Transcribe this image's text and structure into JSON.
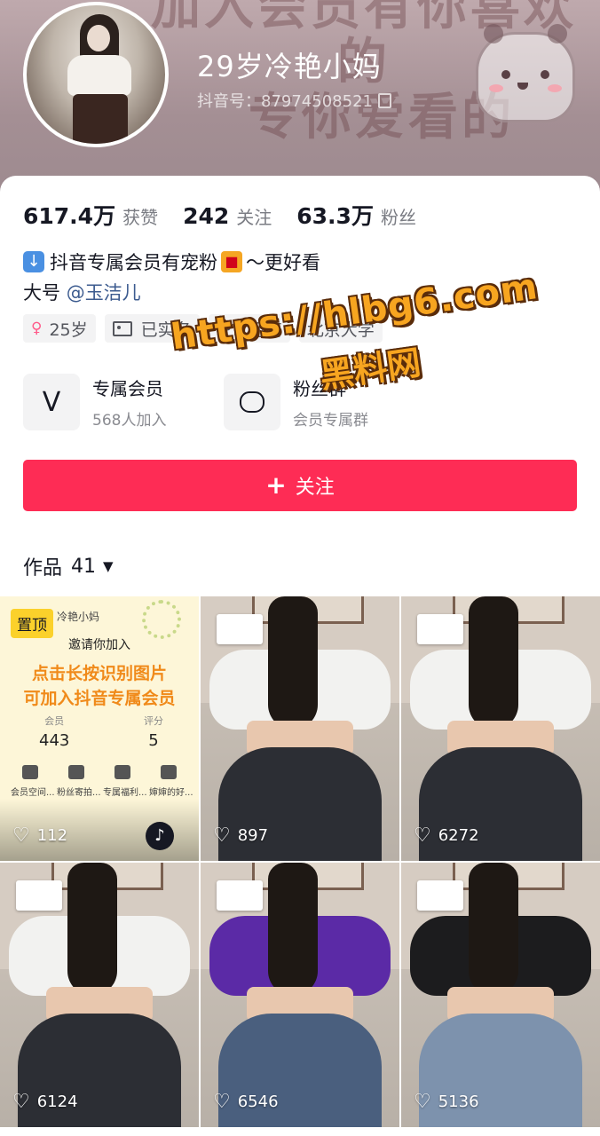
{
  "header": {
    "banner_line1": "加入会员有你喜欢的",
    "banner_line2": "专你爱看的",
    "nickname": "29岁冷艳小妈",
    "douyin_id": "抖音号：87974508521"
  },
  "stats": [
    {
      "value": "617.4万",
      "label": "获赞"
    },
    {
      "value": "242",
      "label": "关注"
    },
    {
      "value": "63.3万",
      "label": "粉丝"
    }
  ],
  "bio": {
    "line1": "抖音专属会员有宠粉",
    "line1_tail": "～更好看",
    "line2_prefix": "大号",
    "mention": "@玉洁儿"
  },
  "tags": [
    {
      "icon": "venus-icon",
      "glyph": "♀",
      "label": "25岁"
    },
    {
      "icon": "id-card-icon",
      "glyph": "",
      "label": "已实名"
    },
    {
      "icon": "",
      "glyph": "",
      "label": "IP：河南"
    },
    {
      "icon": "",
      "glyph": "",
      "label": "北京大学"
    }
  ],
  "entries": [
    {
      "title": "专属会员",
      "sub": "568人加入"
    },
    {
      "title": "粉丝群",
      "sub": "会员专属群"
    }
  ],
  "follow_button": {
    "label": "关注"
  },
  "works": {
    "label": "作品",
    "count": "41"
  },
  "grid": {
    "pinned_badge": "置顶",
    "promo": {
      "title": "冷艳小妈",
      "invite": "邀请你加入",
      "line1": "点击长按识别图片",
      "line2": "可加入抖音专属会员",
      "score_labels": [
        "会员",
        "评分"
      ],
      "score_values": [
        "443",
        "5"
      ],
      "icon_captions": [
        "会员空间...",
        "粉丝寄拍...",
        "专属福利...",
        "婶婶的好..."
      ]
    },
    "likes": [
      "112",
      "897",
      "6272",
      "6124",
      "6546",
      "5136"
    ]
  },
  "watermark": {
    "line1": "https://hlbg6.com",
    "line2": "黑料网"
  },
  "colors": {
    "accent": "#fe2c55",
    "mention": "#3c5b8f",
    "pinned": "#fbd12b"
  }
}
